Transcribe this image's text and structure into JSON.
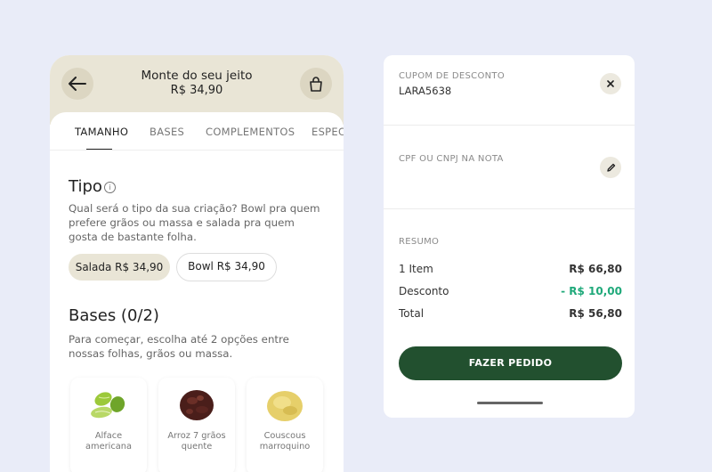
{
  "phone": {
    "header": {
      "title": "Monte do seu jeito",
      "price": "R$ 34,90",
      "back_icon": "arrow-left-icon",
      "bag_icon": "shopping-bag-icon"
    },
    "tabs": [
      {
        "label": "TAMANHO",
        "active": true
      },
      {
        "label": "BASES",
        "active": false
      },
      {
        "label": "COMPLEMENTOS",
        "active": false
      },
      {
        "label": "ESPECIAIS",
        "active": false
      }
    ],
    "tipo": {
      "title": "Tipo",
      "info_icon": "info-icon",
      "description": "Qual será o tipo da sua criação? Bowl pra quem prefere grãos ou massa e salada pra quem gosta de bastante folha.",
      "options": [
        {
          "label": "Salada R$ 34,90",
          "selected": true
        },
        {
          "label": "Bowl R$ 34,90",
          "selected": false
        }
      ]
    },
    "bases": {
      "title": "Bases (0/2)",
      "description": "Para começar, escolha até 2 opções entre nossas folhas, grãos ou massa.",
      "items": [
        {
          "name": "Alface americana",
          "icon": "lettuce-icon"
        },
        {
          "name": "Arroz 7 grãos quente",
          "icon": "rice-icon"
        },
        {
          "name": "Couscous marroquino",
          "icon": "couscous-icon"
        }
      ]
    }
  },
  "summary": {
    "coupon_label": "CUPOM DE DESCONTO",
    "coupon_code": "LARA5638",
    "coupon_remove_icon": "close-icon",
    "cpf_label": "CPF OU CNPJ NA NOTA",
    "cpf_edit_icon": "pencil-icon",
    "resumo_label": "RESUMO",
    "rows": [
      {
        "label": "1 Item",
        "value": "R$ 66,80"
      },
      {
        "label": "Desconto",
        "value": "- R$ 10,00"
      },
      {
        "label": "Total",
        "value": "R$ 56,80"
      }
    ],
    "order_button": "FAZER PEDIDO",
    "colors": {
      "button": "#22502f",
      "discount": "#1fa97a",
      "header_bg": "#e9e5d6"
    }
  }
}
